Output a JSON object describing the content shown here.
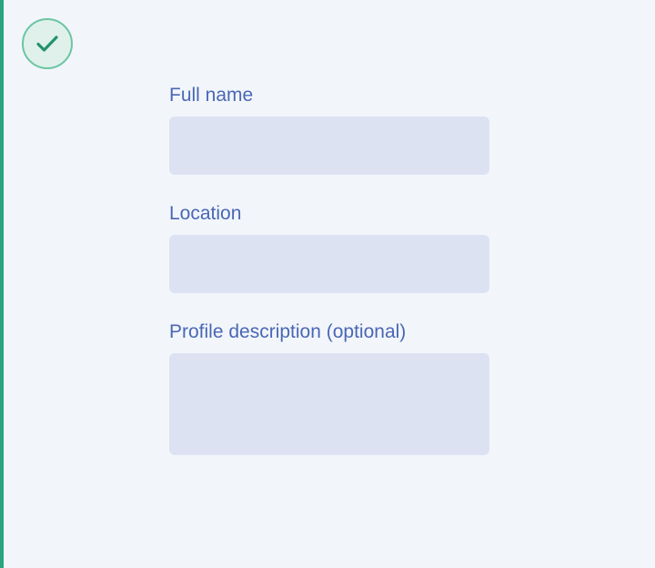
{
  "status_icon": {
    "name": "check-icon",
    "state": "completed",
    "border_color": "#6cc5a3",
    "fill_color": "#dff1ea",
    "check_color": "#24936d"
  },
  "accent_bar": {
    "color": "#2aa57e"
  },
  "form": {
    "full_name": {
      "label": "Full name",
      "value": "",
      "placeholder": ""
    },
    "location": {
      "label": "Location",
      "value": "",
      "placeholder": ""
    },
    "profile_description": {
      "label": "Profile description (optional)",
      "value": "",
      "placeholder": ""
    }
  },
  "colors": {
    "background": "#f2f6fb",
    "label_text": "#4a67b4",
    "input_background": "#dde2f3"
  }
}
